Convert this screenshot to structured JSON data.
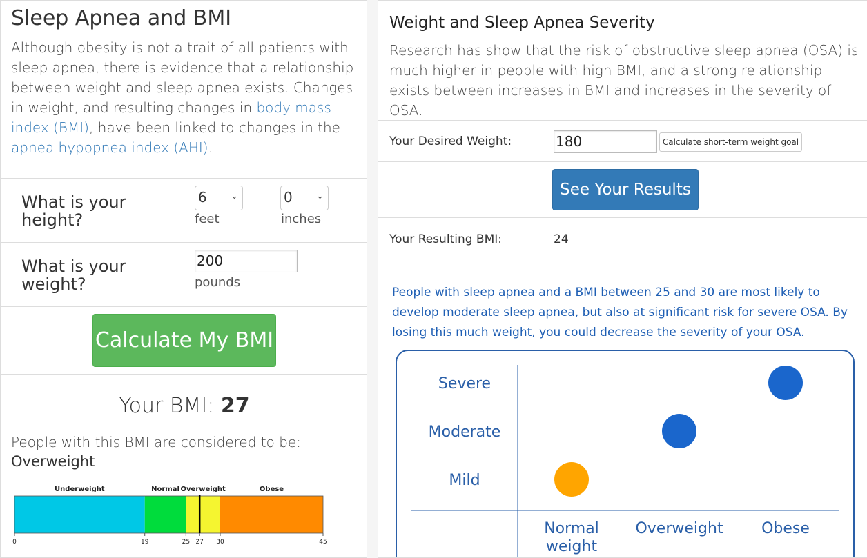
{
  "left": {
    "title": "Sleep Apnea and BMI",
    "intro_1": "Although obesity is not a trait of all patients with sleep apnea, there is evidence that a relationship between weight and sleep apnea exists. Changes in weight, and resulting changes in ",
    "intro_link_bmi": "body mass index (BMI)",
    "intro_2": ", have been linked to changes in the ",
    "intro_link_ahi": "apnea hypopnea index (AHI)",
    "intro_3": ".",
    "height_label": "What is your height?",
    "feet_value": "6",
    "feet_unit": "feet",
    "inches_value": "0",
    "inches_unit": "inches",
    "weight_label": "What is your weight?",
    "weight_value": "200",
    "weight_unit": "pounds",
    "calc_button": "Calculate My BMI",
    "bmi_prefix": "Your BMI: ",
    "bmi_value": "27",
    "considered_text": "People with this BMI are considered to be:",
    "category": "Overweight",
    "scale": {
      "segments": [
        {
          "label": "Underweight",
          "from": 0,
          "to": 19,
          "color": "#00c8e6"
        },
        {
          "label": "Normal",
          "from": 19,
          "to": 25,
          "color": "#00dc3c"
        },
        {
          "label": "Overweight",
          "from": 25,
          "to": 30,
          "color": "#f5f530"
        },
        {
          "label": "Obese",
          "from": 30,
          "to": 45,
          "color": "#ff8a00"
        }
      ],
      "ticks": [
        "0",
        "19",
        "25",
        "27",
        "30",
        "45"
      ],
      "tick_values": [
        0,
        19,
        25,
        27,
        30,
        45
      ],
      "marker_value": 27
    }
  },
  "right": {
    "title": "Weight and Sleep Apnea Severity",
    "research": "Research has show that the risk of obstructive sleep apnea (OSA) is much higher in people with high BMI, and a strong relationship exists between increases in BMI and increases in the severity of OSA.",
    "desired_label": "Your Desired Weight:",
    "desired_value": "180",
    "short_term_button": "Calculate short-term weight goal",
    "results_button": "See Your Results",
    "resulting_label": "Your Resulting BMI:",
    "resulting_value": "24",
    "advice": "People with sleep apnea and a BMI between 25 and 30 are most likely to develop moderate sleep apnea, but also at significant risk for severe OSA. By losing this much weight, you could decrease the severity of your OSA."
  },
  "chart_data": {
    "type": "scatter",
    "y_categories": [
      "Mild",
      "Moderate",
      "Severe"
    ],
    "x_categories": [
      "Normal weight",
      "Overweight",
      "Obese"
    ],
    "points": [
      {
        "x": "Normal weight",
        "y": "Mild",
        "color": "#ffa500"
      },
      {
        "x": "Overweight",
        "y": "Moderate",
        "color": "#1a66cc"
      },
      {
        "x": "Obese",
        "y": "Severe",
        "color": "#1a66cc"
      }
    ],
    "label_color": "#2a5fa8"
  }
}
